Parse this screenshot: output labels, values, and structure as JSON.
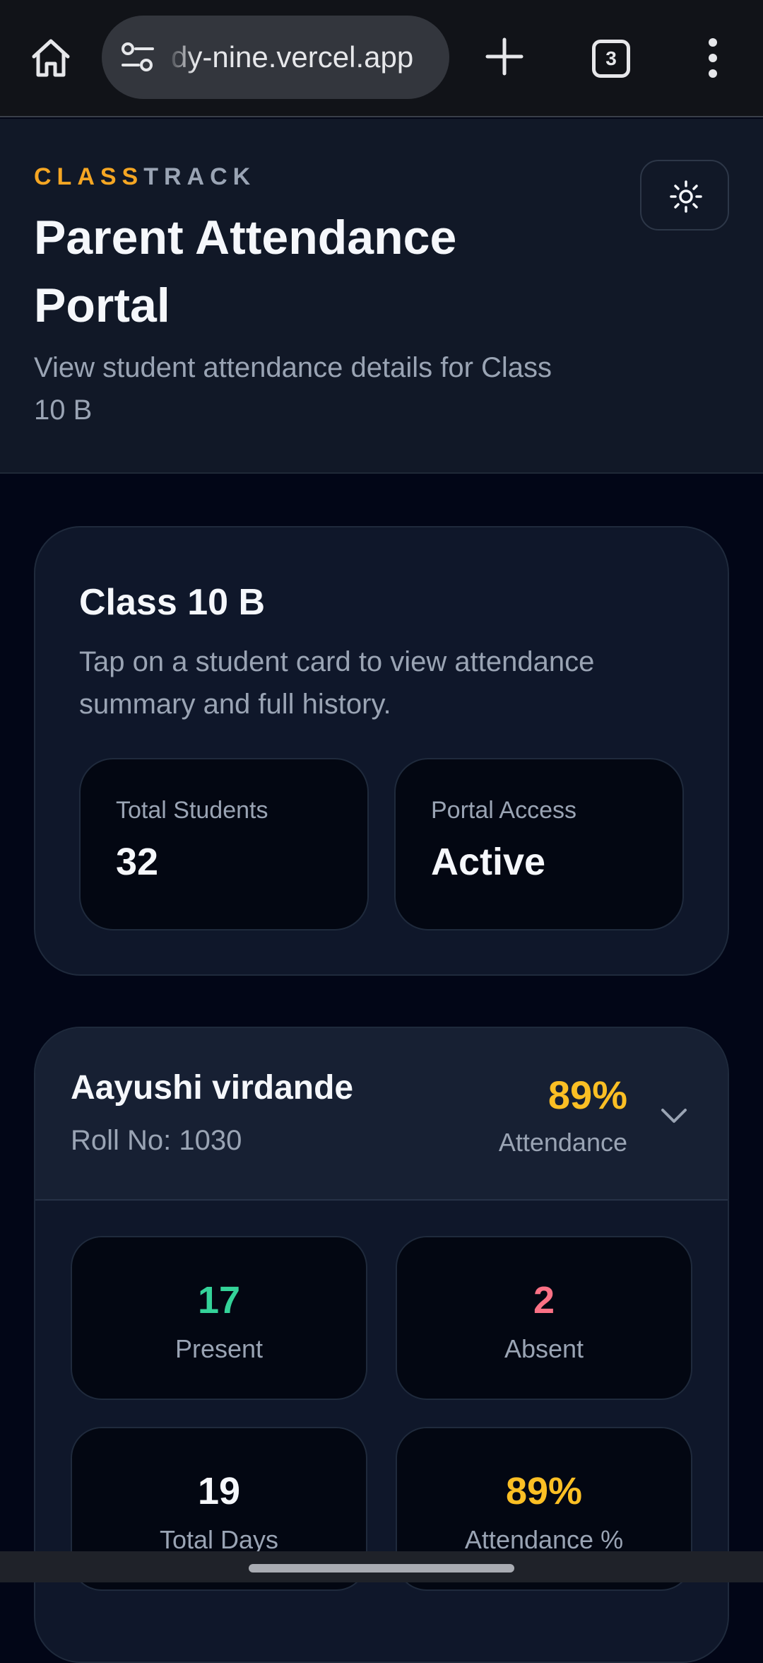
{
  "browser": {
    "url": "dy-nine.vercel.app",
    "tab_count": "3",
    "icons": [
      "home-icon",
      "site-settings-icon",
      "plus-icon",
      "tabs-icon",
      "more-vert-icon"
    ]
  },
  "header": {
    "brand_part1": "CLASS",
    "brand_part2": "TRACK",
    "title": "Parent Attendance Portal",
    "subtitle": "View student attendance details for Class 10 B",
    "theme_icon": "sun-icon"
  },
  "class_card": {
    "title": "Class 10 B",
    "description": "Tap on a student card to view attendance summary and full history.",
    "stats": [
      {
        "label": "Total Students",
        "value": "32"
      },
      {
        "label": "Portal Access",
        "value": "Active"
      }
    ]
  },
  "student": {
    "name": "Aayushi virdande",
    "roll": "Roll No: 1030",
    "percent": "89%",
    "percent_label": "Attendance",
    "expand_icon": "chevron-down-icon",
    "metrics": [
      {
        "value": "17",
        "label": "Present"
      },
      {
        "value": "2",
        "label": "Absent"
      },
      {
        "value": "19",
        "label": "Total Days"
      },
      {
        "value": "89%",
        "label": "Attendance %"
      }
    ]
  },
  "colors": {
    "accent": "#f5a623",
    "present": "#34d399",
    "absent": "#fb7185",
    "percent": "#fbbf24",
    "background": "#020617"
  }
}
